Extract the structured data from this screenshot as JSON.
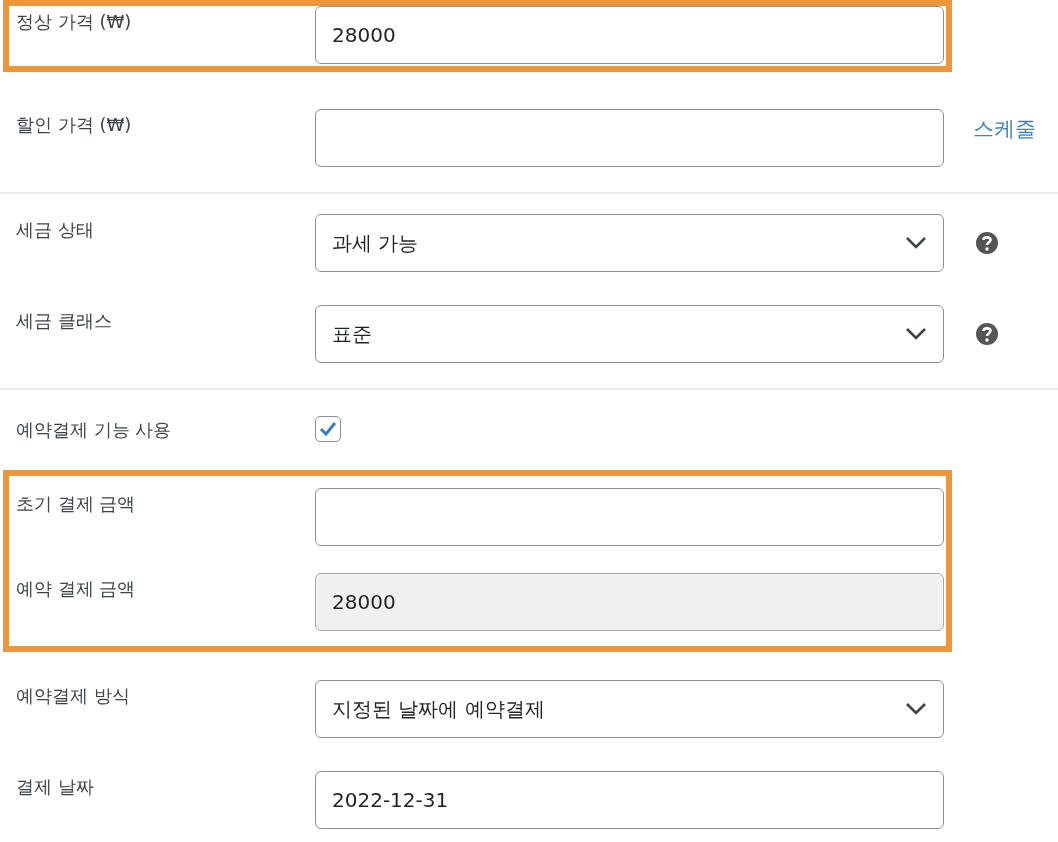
{
  "sections": [
    {
      "groups": [
        {
          "highlighted": true,
          "rows": [
            {
              "kind": "text",
              "label": "정상 가격 (₩)",
              "value": "28000",
              "disabled": false
            }
          ]
        },
        {
          "highlighted": false,
          "rows": [
            {
              "kind": "text",
              "label": "할인 가격 (₩)",
              "value": "",
              "disabled": false,
              "link": "스케줄"
            }
          ]
        }
      ]
    },
    {
      "groups": [
        {
          "highlighted": false,
          "rows": [
            {
              "kind": "select",
              "label": "세금 상태",
              "value": "과세 가능",
              "help": true
            },
            {
              "kind": "select",
              "label": "세금 클래스",
              "value": "표준",
              "help": true
            }
          ]
        }
      ]
    },
    {
      "groups": [
        {
          "highlighted": false,
          "rows": [
            {
              "kind": "checkbox",
              "label": "예약결제 기능 사용",
              "checked": true
            }
          ]
        },
        {
          "highlighted": true,
          "rows": [
            {
              "kind": "text",
              "label": "초기 결제 금액",
              "value": "",
              "disabled": false
            },
            {
              "kind": "text",
              "label": "예약 결제 금액",
              "value": "28000",
              "disabled": true
            }
          ]
        },
        {
          "highlighted": false,
          "rows": [
            {
              "kind": "select",
              "label": "예약결제 방식",
              "value": "지정된 날짜에 예약결제",
              "help": false
            },
            {
              "kind": "text",
              "label": "결제 날짜",
              "value": "2022-12-31",
              "disabled": false
            }
          ]
        }
      ]
    }
  ]
}
